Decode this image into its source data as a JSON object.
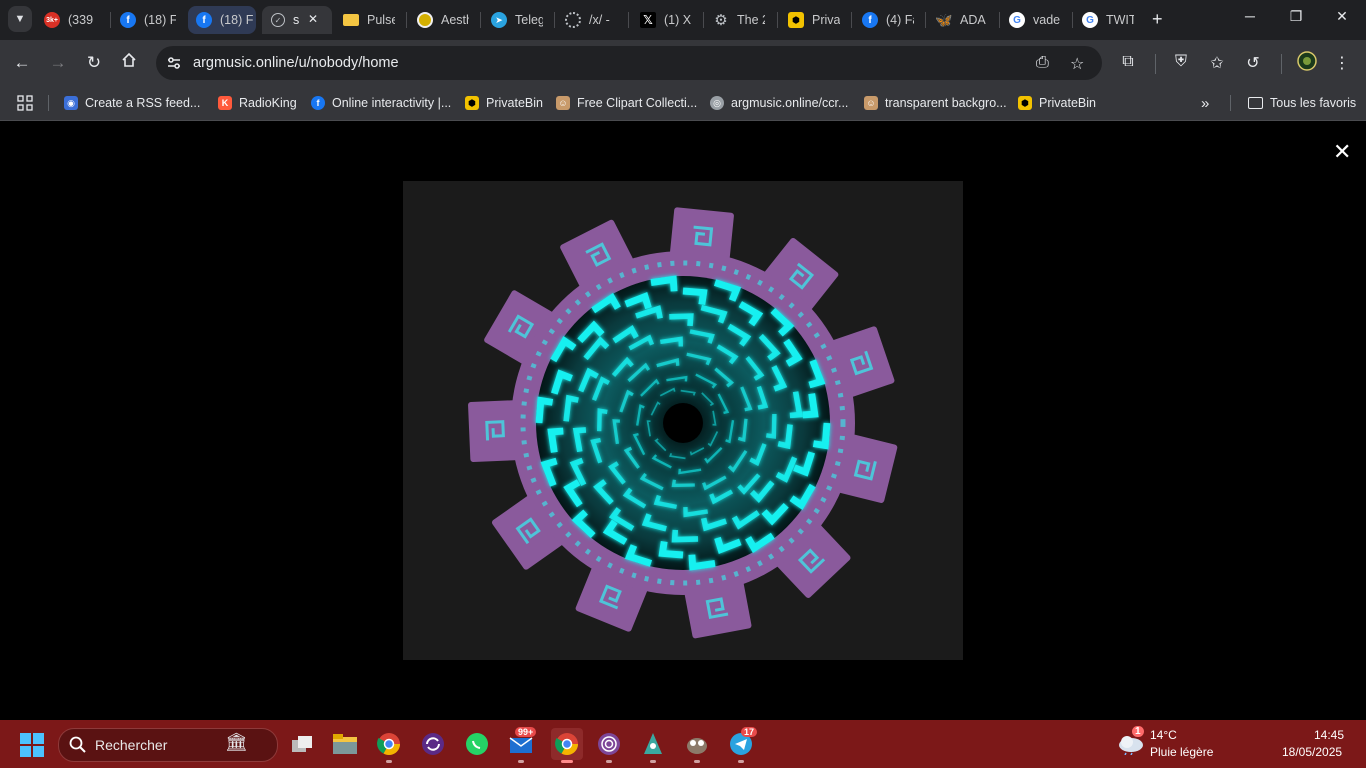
{
  "tabs": [
    {
      "title": "(339",
      "icon": "reddit-icon",
      "color": "#d93025",
      "badge": "3k+"
    },
    {
      "title": "(18) F",
      "icon": "facebook-icon",
      "color": "#1877f2"
    },
    {
      "title": "(18) F",
      "icon": "facebook-icon",
      "color": "#1877f2"
    },
    {
      "title": "s",
      "icon": "check-circle-icon",
      "color": "#9aa0a6"
    },
    {
      "title": "Pulse",
      "icon": "folder-icon",
      "color": "#f4c542"
    },
    {
      "title": "Aesth",
      "icon": "coin-icon",
      "color": "#d4b000"
    },
    {
      "title": "Teleg",
      "icon": "telegram-icon",
      "color": "#2aa3e0"
    },
    {
      "title": "/x/ -",
      "icon": "dotted-circle-icon",
      "color": "#9aa0a6"
    },
    {
      "title": "(1) X",
      "icon": "x-icon",
      "color": "#000000"
    },
    {
      "title": "The 2",
      "icon": "gear-icon",
      "color": "#9aa0a6"
    },
    {
      "title": "Priva",
      "icon": "privatebin-icon",
      "color": "#f2c200"
    },
    {
      "title": "(4) Fa",
      "icon": "facebook-icon",
      "color": "#1877f2"
    },
    {
      "title": "ADA",
      "icon": "butterfly-icon",
      "color": "#1185fe"
    },
    {
      "title": "vade",
      "icon": "google-icon",
      "color": "#ffffff"
    },
    {
      "title": "TWIT",
      "icon": "google-icon",
      "color": "#ffffff"
    }
  ],
  "address": {
    "url": "argmusic.online/u/nobody/home"
  },
  "bookmarks": [
    {
      "label": "Create a RSS feed...",
      "icon": "rss-app-icon",
      "color": "#3b6fd8"
    },
    {
      "label": "RadioKing",
      "icon": "radioking-icon",
      "color": "#ff5a3c"
    },
    {
      "label": "Online interactivity |...",
      "icon": "facebook-icon",
      "color": "#1877f2"
    },
    {
      "label": "PrivateBin",
      "icon": "privatebin-icon",
      "color": "#f2c200"
    },
    {
      "label": "Free Clipart Collecti...",
      "icon": "clipart-icon",
      "color": "#c89a6a"
    },
    {
      "label": "argmusic.online/ccr...",
      "icon": "globe-icon",
      "color": "#9aa0a6"
    },
    {
      "label": "transparent backgro...",
      "icon": "clipart-icon",
      "color": "#c89a6a"
    },
    {
      "label": "PrivateBin",
      "icon": "privatebin-icon",
      "color": "#f2c200"
    }
  ],
  "bookmarks_all": "Tous les favoris",
  "taskbar": {
    "search_label": "Rechercher",
    "badges": {
      "mail": "99+",
      "telegram": "17",
      "weather": "1"
    },
    "weather_temp": "14°C",
    "weather_desc": "Pluie légère",
    "time": "14:45",
    "date": "18/05/2025"
  },
  "colors": {
    "gear_purple": "#8a5a9c",
    "glow_cyan": "#18f0f0",
    "taskbar": "#7c1818"
  }
}
